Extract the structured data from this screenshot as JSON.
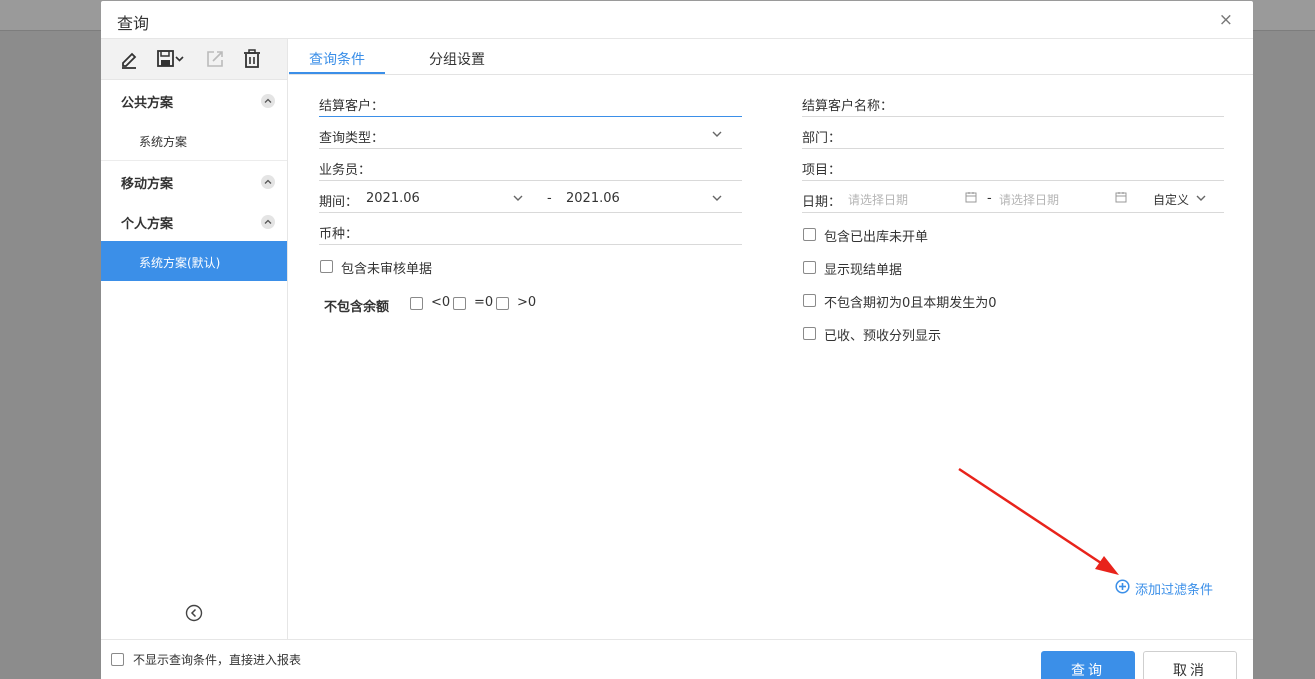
{
  "dialog": {
    "title": "查询",
    "close_icon": "×"
  },
  "sidebar": {
    "toolbar_icons": [
      "edit-icon",
      "save-icon",
      "export-icon",
      "delete-icon"
    ],
    "groups": [
      {
        "label": "公共方案",
        "items": [
          {
            "label": "系统方案",
            "active": false
          }
        ]
      },
      {
        "label": "移动方案",
        "items": []
      },
      {
        "label": "个人方案",
        "items": [
          {
            "label": "系统方案(默认)",
            "active": true
          }
        ]
      }
    ]
  },
  "tabs": [
    {
      "label": "查询条件",
      "active": true
    },
    {
      "label": "分组设置",
      "active": false
    }
  ],
  "form": {
    "customer": {
      "label": "结算客户：",
      "value": ""
    },
    "query_type": {
      "label": "查询类型：",
      "value": ""
    },
    "salesperson": {
      "label": "业务员：",
      "value": ""
    },
    "period": {
      "label": "期间：",
      "from": "2021.06",
      "sep": "-",
      "to": "2021.06"
    },
    "currency": {
      "label": "币种：",
      "value": ""
    },
    "include_unaudited": {
      "label": "包含未审核单据",
      "checked": false
    },
    "exclude_balance": {
      "label": "不包含余额",
      "options": [
        {
          "label": "<0",
          "checked": false
        },
        {
          "label": "=0",
          "checked": false
        },
        {
          "label": ">0",
          "checked": false
        }
      ]
    },
    "customer_name": {
      "label": "结算客户名称：",
      "value": ""
    },
    "department": {
      "label": "部门：",
      "value": ""
    },
    "project": {
      "label": "项目：",
      "value": ""
    },
    "date": {
      "label": "日期：",
      "from_placeholder": "请选择日期",
      "sep": "-",
      "to_placeholder": "请选择日期",
      "mode": "自定义"
    },
    "right_checks": [
      {
        "label": "包含已出库未开单",
        "checked": false
      },
      {
        "label": "显示现结单据",
        "checked": false
      },
      {
        "label": "不包含期初为0且本期发生为0",
        "checked": false
      },
      {
        "label": "已收、预收分列显示",
        "checked": false
      }
    ],
    "add_filter": "添加过滤条件"
  },
  "footer": {
    "skip_label": "不显示查询条件，直接进入报表",
    "skip_checked": false,
    "query_button": "查询",
    "cancel_button": "取消"
  },
  "colors": {
    "accent": "#3b8fe8",
    "annotation_arrow": "#e8231b"
  }
}
